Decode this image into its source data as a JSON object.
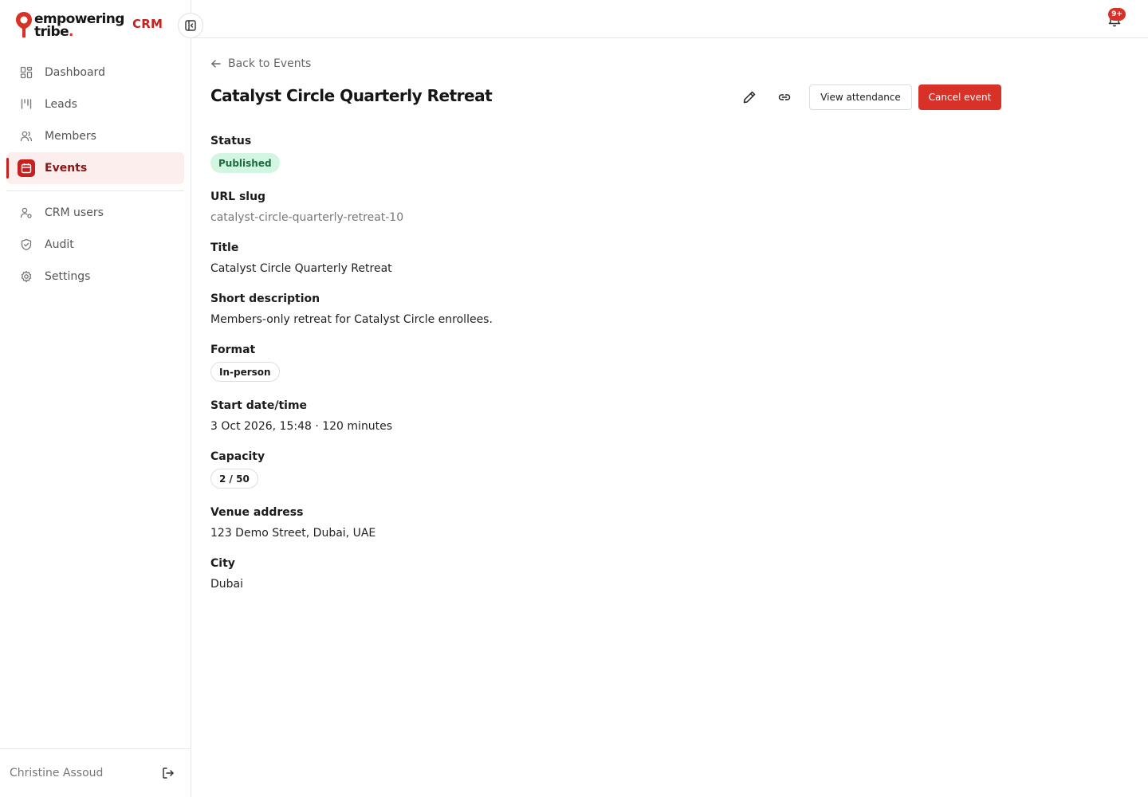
{
  "brand": {
    "line1": "empowering",
    "line2": "tribe",
    "dot": ".",
    "crm_label": "CRM"
  },
  "sidebar": {
    "items": [
      {
        "label": "Dashboard",
        "icon": "dashboard-icon"
      },
      {
        "label": "Leads",
        "icon": "leads-icon"
      },
      {
        "label": "Members",
        "icon": "members-icon"
      },
      {
        "label": "Events",
        "icon": "calendar-icon",
        "active": true
      }
    ],
    "secondary_items": [
      {
        "label": "CRM users",
        "icon": "user-cog-icon"
      },
      {
        "label": "Audit",
        "icon": "shield-icon"
      },
      {
        "label": "Settings",
        "icon": "gear-icon"
      }
    ],
    "user_name": "Christine Assoud"
  },
  "topbar": {
    "notification_count": "9+"
  },
  "page": {
    "back_label": "Back to Events",
    "title": "Catalyst Circle Quarterly Retreat",
    "actions": {
      "view_attendance": "View attendance",
      "cancel_event": "Cancel event"
    }
  },
  "details": {
    "status": {
      "label": "Status",
      "value": "Published"
    },
    "url_slug": {
      "label": "URL slug",
      "value": "catalyst-circle-quarterly-retreat-10"
    },
    "title": {
      "label": "Title",
      "value": "Catalyst Circle Quarterly Retreat"
    },
    "short_description": {
      "label": "Short description",
      "value": "Members-only retreat for Catalyst Circle enrollees."
    },
    "format": {
      "label": "Format",
      "value": "In-person"
    },
    "start": {
      "label": "Start date/time",
      "value": "3 Oct 2026, 15:48 · 120 minutes"
    },
    "capacity": {
      "label": "Capacity",
      "value": "2 / 50"
    },
    "venue": {
      "label": "Venue address",
      "value": "123 Demo Street, Dubai, UAE"
    },
    "city": {
      "label": "City",
      "value": "Dubai"
    }
  },
  "colors": {
    "accent": "#d83127",
    "active_bg": "#fdeeee",
    "published_bg": "#d3f6e3",
    "published_text": "#1a6b3f"
  }
}
